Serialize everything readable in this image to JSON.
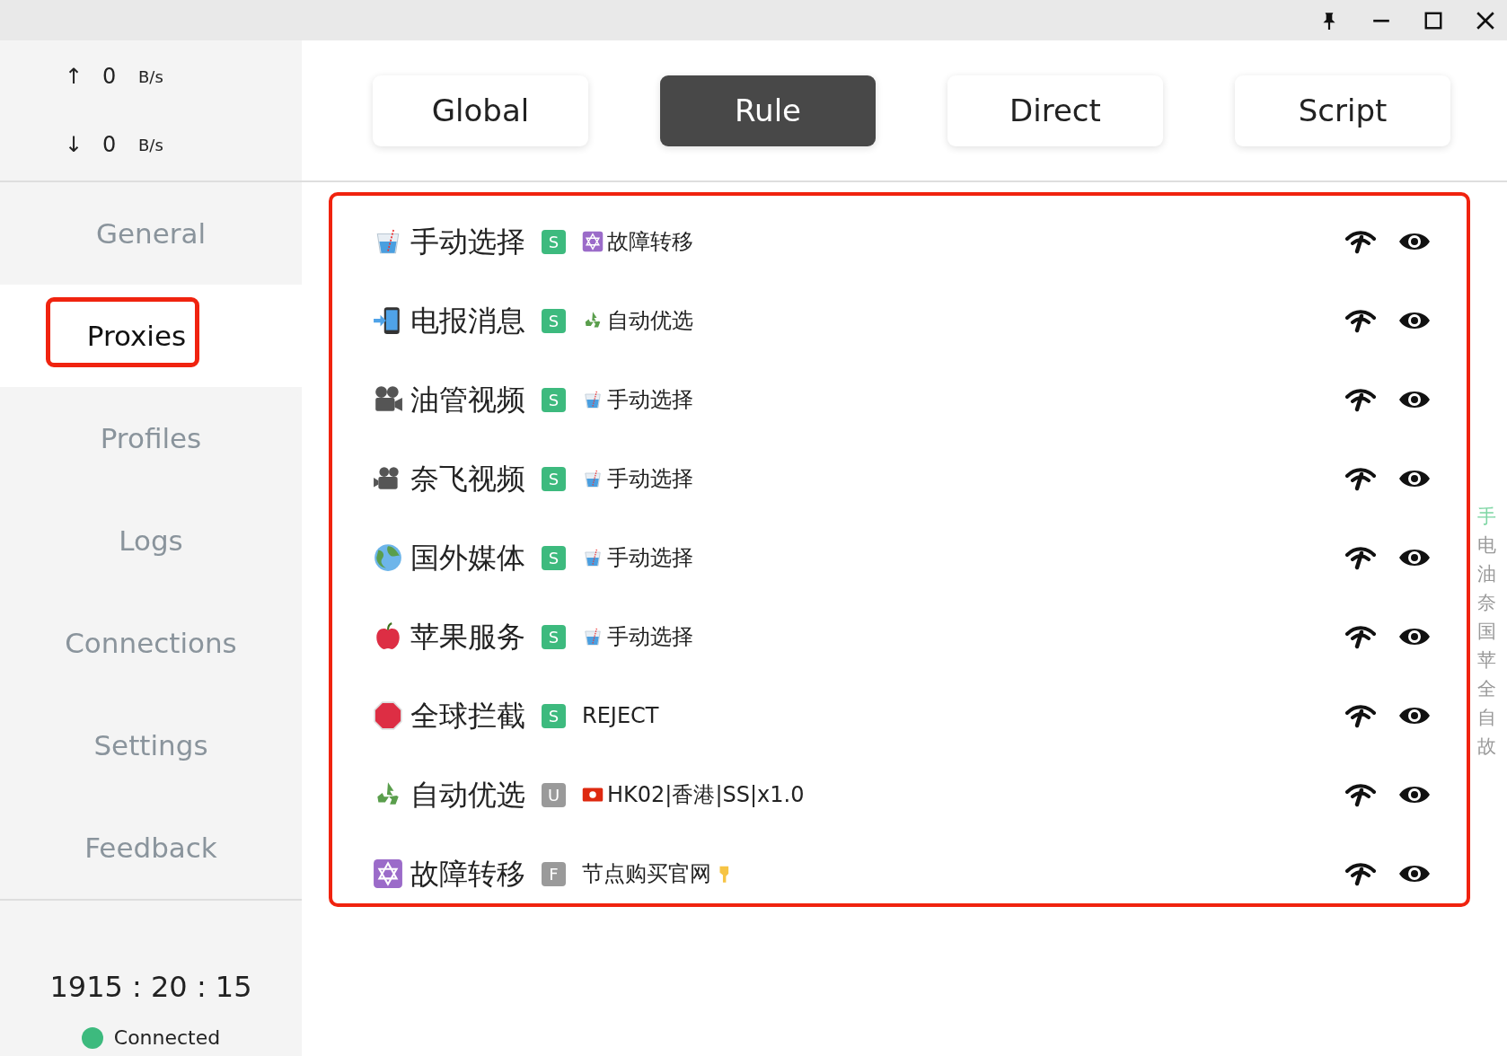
{
  "traffic": [
    {
      "arrow": "↑",
      "value": "0",
      "unit": "B/s"
    },
    {
      "arrow": "↓",
      "value": "0",
      "unit": "B/s"
    }
  ],
  "nav": [
    {
      "label": "General",
      "selected": false,
      "highlighted": false
    },
    {
      "label": "Proxies",
      "selected": true,
      "highlighted": true
    },
    {
      "label": "Profiles",
      "selected": false,
      "highlighted": false
    },
    {
      "label": "Logs",
      "selected": false,
      "highlighted": false
    },
    {
      "label": "Connections",
      "selected": false,
      "highlighted": false
    },
    {
      "label": "Settings",
      "selected": false,
      "highlighted": false
    },
    {
      "label": "Feedback",
      "selected": false,
      "highlighted": false
    }
  ],
  "uptime": "1915 : 20 : 15",
  "status": {
    "label": "Connected",
    "connected": true
  },
  "modes": [
    {
      "label": "Global",
      "selected": false
    },
    {
      "label": "Rule",
      "selected": true
    },
    {
      "label": "Direct",
      "selected": false
    },
    {
      "label": "Script",
      "selected": false
    }
  ],
  "proxy_groups": {
    "highlighted": true,
    "groups": [
      {
        "name": "手动选择",
        "type": "S",
        "kind": "select",
        "now": "故障转移"
      },
      {
        "name": "电报消息",
        "type": "S",
        "kind": "select",
        "now": "自动优选"
      },
      {
        "name": "油管视频",
        "type": "S",
        "kind": "select",
        "now": "手动选择"
      },
      {
        "name": "奈飞视频",
        "type": "S",
        "kind": "select",
        "now": "手动选择"
      },
      {
        "name": "国外媒体",
        "type": "S",
        "kind": "select",
        "now": "手动选择"
      },
      {
        "name": "苹果服务",
        "type": "S",
        "kind": "select",
        "now": "手动选择"
      },
      {
        "name": "全球拦截",
        "type": "S",
        "kind": "select",
        "now": "REJECT"
      },
      {
        "name": "自动优选",
        "type": "U",
        "kind": "url-test",
        "now": "HK02|香港|SS|x1.0"
      },
      {
        "name": "故障转移",
        "type": "F",
        "kind": "fallback",
        "now": "节点购买官网"
      }
    ]
  },
  "index": [
    {
      "char": "手",
      "selected": true
    },
    {
      "char": "电",
      "selected": false
    },
    {
      "char": "油",
      "selected": false
    },
    {
      "char": "奈",
      "selected": false
    },
    {
      "char": "国",
      "selected": false
    },
    {
      "char": "苹",
      "selected": false
    },
    {
      "char": "全",
      "selected": false
    },
    {
      "char": "自",
      "selected": false
    },
    {
      "char": "故",
      "selected": false
    }
  ]
}
